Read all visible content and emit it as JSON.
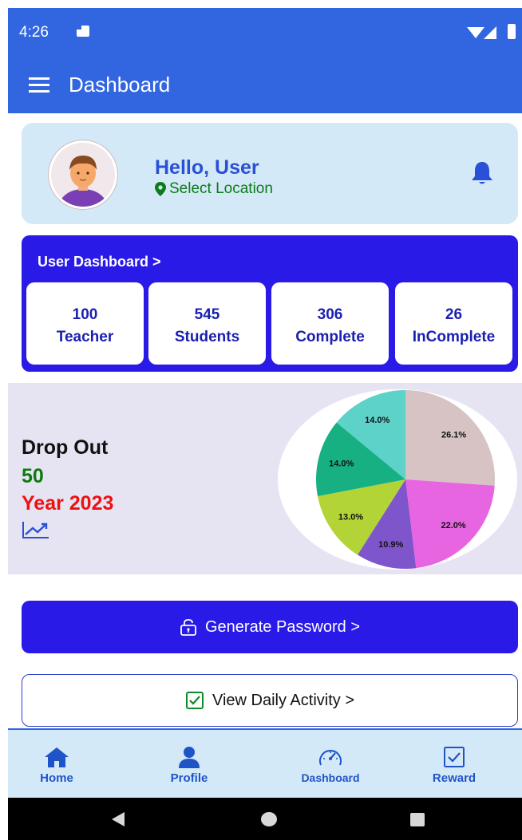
{
  "status_bar": {
    "time": "4:26",
    "icons": [
      "sd-card-icon",
      "wifi-icon",
      "signal-icon",
      "battery-icon"
    ]
  },
  "app_bar": {
    "title": "Dashboard",
    "menu_icon": "hamburger-menu-icon"
  },
  "greeting": {
    "name": "Hello, User",
    "location": "Select Location",
    "bell_icon": "bell-icon"
  },
  "user_dashboard": {
    "heading": "User Dashboard >",
    "stats": [
      {
        "value": "100",
        "label": "Teacher"
      },
      {
        "value": "545",
        "label": "Students"
      },
      {
        "value": "306",
        "label": "Complete"
      },
      {
        "value": "26",
        "label": "InComplete"
      }
    ]
  },
  "dropout": {
    "title": "Drop Out",
    "count": "50",
    "year": "Year 2023",
    "trend_icon": "trending-up-icon"
  },
  "chart_data": {
    "type": "pie",
    "values": [
      26.1,
      22.0,
      10.9,
      13.0,
      14.0,
      14.0
    ],
    "labels": [
      "26.1%",
      "22.0%",
      "10.9%",
      "13.0%",
      "14.0%",
      "14.0%"
    ],
    "colors": [
      "#d7c3c4",
      "#e865e2",
      "#7f55cc",
      "#b3d436",
      "#16b083",
      "#5cd2c9"
    ]
  },
  "buttons": {
    "generate_password": "Generate Password >",
    "view_daily_activity": "View Daily Activity >"
  },
  "bottom_nav": [
    {
      "label": "Home",
      "icon": "home-icon"
    },
    {
      "label": "Profile",
      "icon": "user-icon"
    },
    {
      "label": "Dashboard",
      "icon": "speedometer-icon"
    },
    {
      "label": "Reward",
      "icon": "checkbox-icon"
    }
  ],
  "colors": {
    "primary": "#3265e0",
    "accent": "#2a1ae8",
    "card_bg": "#d4e9f7",
    "dropout_bg": "#e6e4f3",
    "green": "#0e7a0e",
    "red": "#ee1111"
  }
}
